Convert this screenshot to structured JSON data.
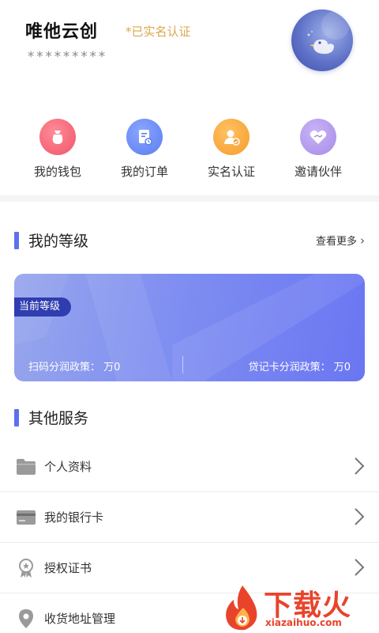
{
  "profile": {
    "name": "唯他云创",
    "verified_label": "*已实名认证",
    "masked_account": "*********"
  },
  "quick_menu": [
    {
      "label": "我的钱包",
      "icon": "wallet-bag-icon",
      "color": "#f0566a"
    },
    {
      "label": "我的订单",
      "icon": "order-document-icon",
      "color": "#5b7df0"
    },
    {
      "label": "实名认证",
      "icon": "verified-user-icon",
      "color": "#f59c2a"
    },
    {
      "label": "邀请伙伴",
      "icon": "heart-handshake-icon",
      "color": "#a78be8"
    }
  ],
  "level_section": {
    "title": "我的等级",
    "more_label": "查看更多",
    "badge": "当前等级",
    "scan_policy": "扫码分润政策： 万0",
    "card_policy": "贷记卡分润政策： 万0"
  },
  "services": {
    "title": "其他服务",
    "items": [
      {
        "label": "个人资料",
        "icon": "folder-icon"
      },
      {
        "label": "我的银行卡",
        "icon": "bank-card-icon"
      },
      {
        "label": "授权证书",
        "icon": "certificate-badge-icon"
      },
      {
        "label": "收货地址管理",
        "icon": "location-pin-icon"
      }
    ]
  },
  "watermark": {
    "brand": "下载火",
    "domain": "xiazaihuo.com"
  },
  "colors": {
    "accent": "#5e6ff0",
    "verified": "#d9a84e",
    "card_start": "#97a6ec",
    "card_end": "#6a76f2",
    "badge": "#2f3db0"
  }
}
